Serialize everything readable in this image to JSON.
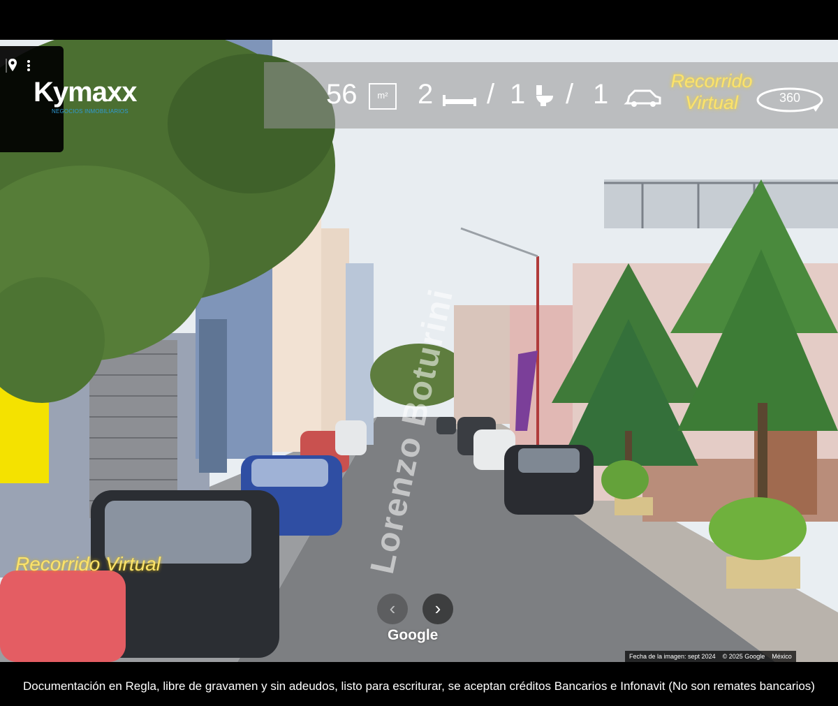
{
  "logo": {
    "wordmark": "Kymaxx",
    "tagline": "NEGOCIOS INMOBILIARIOS"
  },
  "top_icons": {
    "pin": "map-pin-icon",
    "menu": "more-vertical-icon"
  },
  "specs": {
    "area": "56",
    "area_unit": "m²",
    "bedrooms": "2",
    "bathrooms": "1",
    "parking": "1",
    "sep": "/"
  },
  "virtual_tour": {
    "line1": "Recorrido",
    "line2": "Virtual",
    "badge": "360"
  },
  "watermark": "Recorrido Virtual",
  "street_label": "Lorenzo Boturini",
  "google": {
    "logo": "Google",
    "date": "Fecha de la imagen: sept 2024",
    "copyright": "© 2025 Google",
    "region": "México"
  },
  "footer": "Documentación en Regla, libre de gravamen y sin adeudos, listo para escriturar, se aceptan créditos Bancarios e Infonavit (No son remates bancarios)",
  "colors": {
    "accent_gold": "#fce36a",
    "brand_blue": "#2f9bd6"
  }
}
